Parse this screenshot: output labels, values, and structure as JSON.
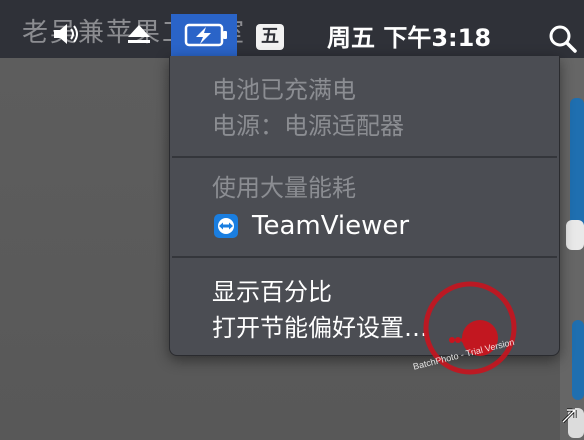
{
  "menubar": {
    "watermark_text": "老吴兼苹果工作室",
    "volume_icon": "speaker-icon",
    "eject_icon": "eject-icon",
    "battery_icon": "battery-charging-icon",
    "input_method_label": "五",
    "clock": "周五 下午3:18",
    "search_icon": "search-icon"
  },
  "battery_menu": {
    "status_full": "电池已充满电",
    "power_source": "电源：电源适配器",
    "heavy_usage_header": "使用大量能耗",
    "apps": [
      {
        "name": "TeamViewer",
        "icon": "teamviewer-icon"
      }
    ],
    "show_percentage": "显示百分比",
    "open_energy_saver": "打开节能偏好设置…"
  },
  "watermark": {
    "stamp_text": "BatchPhoto - Trial Version"
  },
  "colors": {
    "menubar_bg": "#2f3138",
    "menu_bg": "#4b4d53",
    "highlight": "#2a64c8",
    "disabled_text": "#8b8d92",
    "stamp_red": "#c8141e"
  }
}
